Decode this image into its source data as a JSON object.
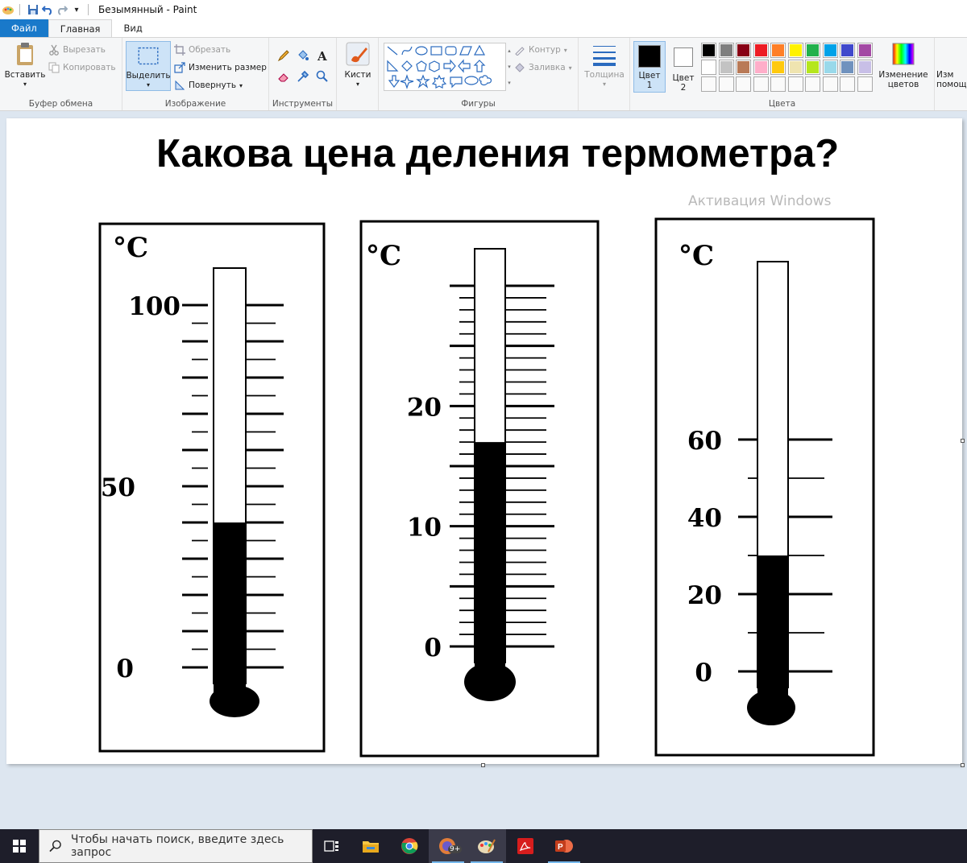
{
  "app": {
    "title": "Безымянный - Paint"
  },
  "tabs": [
    {
      "label": "Файл"
    },
    {
      "label": "Главная"
    },
    {
      "label": "Вид"
    }
  ],
  "ribbon": {
    "clipboard": {
      "label": "Буфер обмена",
      "paste": "Вставить",
      "cut": "Вырезать",
      "copy": "Копировать"
    },
    "image": {
      "label": "Изображение",
      "select": "Выделить",
      "crop": "Обрезать",
      "resize": "Изменить размер",
      "rotate": "Повернуть"
    },
    "tools": {
      "label": "Инструменты"
    },
    "brushes": {
      "label": "Кисти"
    },
    "shapes": {
      "label": "Фигуры",
      "outline": "Контур",
      "fill": "Заливка"
    },
    "size": {
      "label": "Толщина"
    },
    "colors": {
      "label": "Цвета",
      "color1": "Цвет 1",
      "color2": "Цвет 2",
      "edit": "Изменение цветов",
      "help_partial": "Изм помощ",
      "palette_row1": [
        "#000000",
        "#7f7f7f",
        "#880015",
        "#ed1c24",
        "#ff7f27",
        "#fff200",
        "#22b14c",
        "#00a2e8",
        "#3f48cc",
        "#a349a4"
      ],
      "palette_row2": [
        "#ffffff",
        "#c3c3c3",
        "#b97a57",
        "#ffaec9",
        "#ffc90e",
        "#efe4b0",
        "#b5e61d",
        "#99d9ea",
        "#7092be",
        "#c8bfe7"
      ]
    }
  },
  "canvas": {
    "heading": "Какова цена деления термометра?",
    "unit": "°C",
    "thermometers": [
      {
        "labels": [
          "100",
          "50",
          "0"
        ],
        "level": 40
      },
      {
        "labels": [
          "20",
          "10",
          "0"
        ],
        "level": 17
      },
      {
        "labels": [
          "60",
          "40",
          "20",
          "0"
        ],
        "level": 30
      }
    ],
    "watermark": "Активация Windows"
  },
  "taskbar": {
    "search_placeholder": "Чтобы начать поиск, введите здесь запрос",
    "apps": [
      "task-view",
      "file-explorer",
      "chrome",
      "app-notification",
      "paint",
      "acrobat",
      "powerpoint"
    ],
    "badge": "9+"
  }
}
